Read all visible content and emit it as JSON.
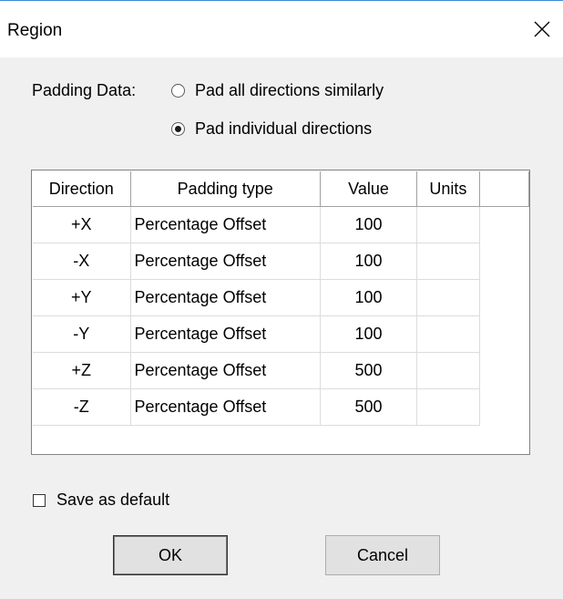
{
  "window": {
    "title": "Region"
  },
  "padding": {
    "label": "Padding Data:",
    "options": [
      {
        "label": "Pad all directions similarly",
        "selected": false
      },
      {
        "label": "Pad individual directions",
        "selected": true
      }
    ]
  },
  "table": {
    "headers": [
      "Direction",
      "Padding type",
      "Value",
      "Units",
      ""
    ],
    "rows": [
      {
        "direction": "+X",
        "type": "Percentage Offset",
        "value": "100",
        "units": ""
      },
      {
        "direction": "-X",
        "type": "Percentage Offset",
        "value": "100",
        "units": ""
      },
      {
        "direction": "+Y",
        "type": "Percentage Offset",
        "value": "100",
        "units": ""
      },
      {
        "direction": "-Y",
        "type": "Percentage Offset",
        "value": "100",
        "units": ""
      },
      {
        "direction": "+Z",
        "type": "Percentage Offset",
        "value": "500",
        "units": ""
      },
      {
        "direction": "-Z",
        "type": "Percentage Offset",
        "value": "500",
        "units": ""
      }
    ]
  },
  "save_default": {
    "label": "Save as default",
    "checked": false
  },
  "buttons": {
    "ok": "OK",
    "cancel": "Cancel"
  },
  "icons": {
    "close": "close-icon"
  }
}
